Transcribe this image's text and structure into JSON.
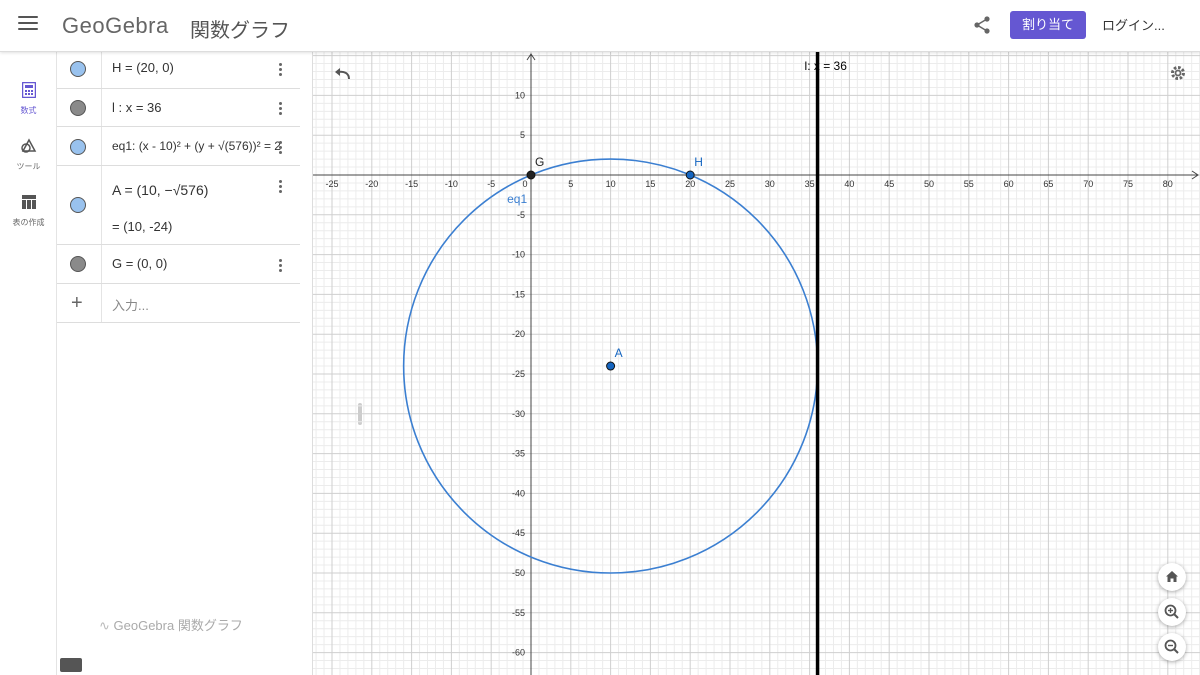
{
  "header": {
    "logo_text": "GeoGebra",
    "app_title": "関数グラフ",
    "assign_label": "割り当て",
    "login_label": "ログイン...",
    "accent_color": "#6557d2"
  },
  "rail": [
    {
      "label": "数式",
      "icon": "calculator-icon",
      "active": true
    },
    {
      "label": "ツール",
      "icon": "tools-icon",
      "active": false
    },
    {
      "label": "表の作成",
      "icon": "table-icon",
      "active": false
    }
  ],
  "algebra": {
    "rows": [
      {
        "text": "H = (20, 0)",
        "marble_color": "#99c2ee"
      },
      {
        "text": "l : x = 36",
        "marble_color": "#8a8a8a"
      },
      {
        "text": "eq1: (x - 10)² + (y + √(576))² = 2",
        "marble_color": "#99c2ee"
      },
      {
        "text": "A = (10, −√576)",
        "text2": "= (10, -24)",
        "marble_color": "#99c2ee"
      },
      {
        "text": "G = (0, 0)",
        "marble_color": "#8a8a8a"
      }
    ],
    "input_placeholder": "入力...",
    "footer_brand": "GeoGebra 関数グラフ"
  },
  "graphics": {
    "x_ticks": [
      "-25",
      "-20",
      "-15",
      "-10",
      "-5",
      "0",
      "5",
      "10",
      "15",
      "20",
      "25",
      "30",
      "35",
      "40",
      "45",
      "50",
      "55",
      "60",
      "65",
      "70",
      "75",
      "80"
    ],
    "y_ticks": [
      "10",
      "5",
      "-5",
      "-10",
      "-15",
      "-20",
      "-25",
      "-30",
      "-35",
      "-40",
      "-45",
      "-50",
      "-55",
      "-60"
    ],
    "line_label": "l: x = 36",
    "circle_label": "eq1",
    "points": [
      {
        "name": "G",
        "x": 0,
        "y": 0,
        "color": "#222222"
      },
      {
        "name": "H",
        "x": 20,
        "y": 0,
        "color": "#1565c0"
      },
      {
        "name": "A",
        "x": 10,
        "y": -24,
        "color": "#1565c0"
      }
    ],
    "circle": {
      "cx": 10,
      "cy": -24,
      "r": 26,
      "color": "#3b7fd1"
    },
    "line": {
      "x": 36,
      "color": "#000000"
    }
  }
}
